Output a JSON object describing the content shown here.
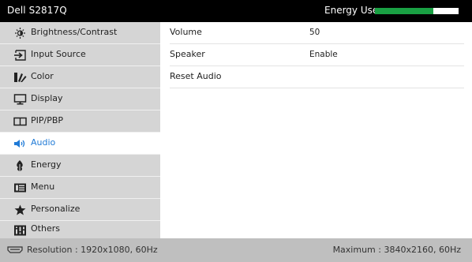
{
  "header": {
    "title": "Dell S2817Q",
    "energy_label": "Energy Use",
    "energy_level": 0.7,
    "energy_color": "#19a043"
  },
  "sidebar": {
    "items": [
      {
        "label": "Brightness/Contrast",
        "icon": "brightness-icon"
      },
      {
        "label": "Input Source",
        "icon": "input-source-icon"
      },
      {
        "label": "Color",
        "icon": "color-icon"
      },
      {
        "label": "Display",
        "icon": "display-icon"
      },
      {
        "label": "PIP/PBP",
        "icon": "pip-icon"
      },
      {
        "label": "Audio",
        "icon": "speaker-icon",
        "active": true
      },
      {
        "label": "Energy",
        "icon": "energy-icon"
      },
      {
        "label": "Menu",
        "icon": "menu-icon"
      },
      {
        "label": "Personalize",
        "icon": "star-icon"
      },
      {
        "label": "Others",
        "icon": "others-icon"
      }
    ]
  },
  "content": {
    "rows": [
      {
        "name": "Volume",
        "value": "50"
      },
      {
        "name": "Speaker",
        "value": "Enable"
      },
      {
        "name": "Reset Audio",
        "value": ""
      }
    ]
  },
  "footer": {
    "resolution": "Resolution : 1920x1080, 60Hz",
    "maximum": "Maximum : 3840x2160, 60Hz"
  },
  "colors": {
    "accent": "#1f7ad6",
    "sidebar_bg": "#d5d5d5",
    "header_bg": "#000000",
    "footer_bg": "#bfbfbf"
  }
}
